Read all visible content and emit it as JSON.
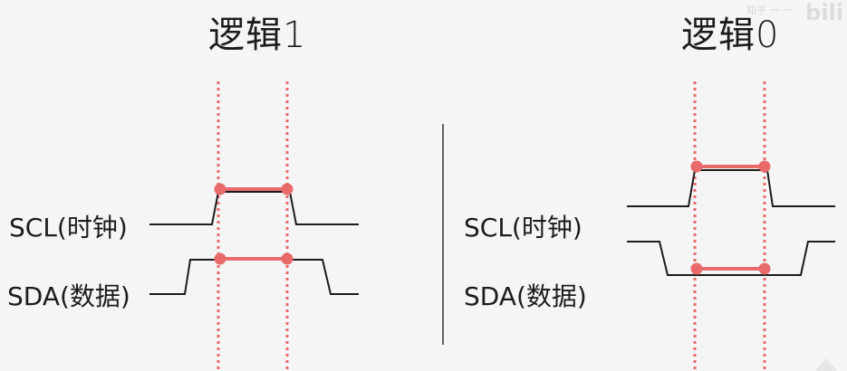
{
  "panels": {
    "left": {
      "title": "逻辑1",
      "scl_label": "SCL(时钟)",
      "sda_label": "SDA(数据)"
    },
    "right": {
      "title": "逻辑0",
      "scl_label": "SCL(时钟)",
      "sda_label": "SDA(数据)"
    }
  },
  "watermark": {
    "logo": "bili",
    "text": "知乎 一 一"
  },
  "colors": {
    "signal": "#1c1c1c",
    "marker": "#e86a6a",
    "divider": "#333333",
    "background": "#f5f5f5"
  }
}
